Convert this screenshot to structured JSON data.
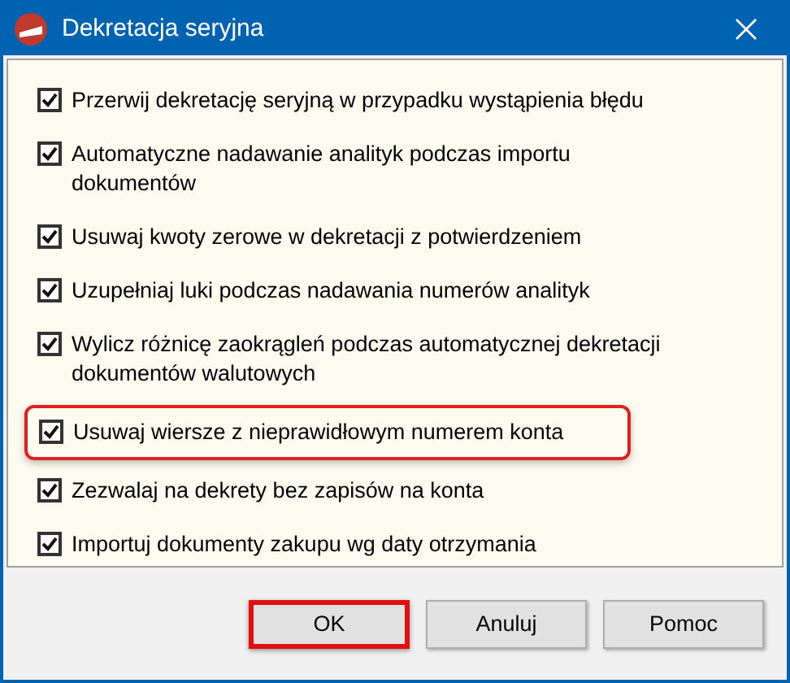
{
  "window": {
    "title": "Dekretacja seryjna"
  },
  "options": [
    {
      "label": "Przerwij dekretację seryjną w przypadku wystąpienia błędu",
      "checked": true,
      "highlighted": false
    },
    {
      "label": "Automatyczne nadawanie analityk podczas importu dokumentów",
      "checked": true,
      "highlighted": false
    },
    {
      "label": "Usuwaj kwoty zerowe w dekretacji z potwierdzeniem",
      "checked": true,
      "highlighted": false
    },
    {
      "label": "Uzupełniaj luki podczas nadawania numerów analityk",
      "checked": true,
      "highlighted": false
    },
    {
      "label": "Wylicz różnicę zaokrągleń podczas automatycznej dekretacji dokumentów walutowych",
      "checked": true,
      "highlighted": false
    },
    {
      "label": "Usuwaj wiersze z nieprawidłowym numerem konta",
      "checked": true,
      "highlighted": true
    },
    {
      "label": "Zezwalaj na dekrety bez zapisów na konta",
      "checked": true,
      "highlighted": false
    },
    {
      "label": "Importuj dokumenty zakupu wg daty otrzymania",
      "checked": true,
      "highlighted": false
    }
  ],
  "buttons": [
    {
      "label": "OK",
      "highlighted": true
    },
    {
      "label": "Anuluj",
      "highlighted": false
    },
    {
      "label": "Pomoc",
      "highlighted": false
    }
  ]
}
